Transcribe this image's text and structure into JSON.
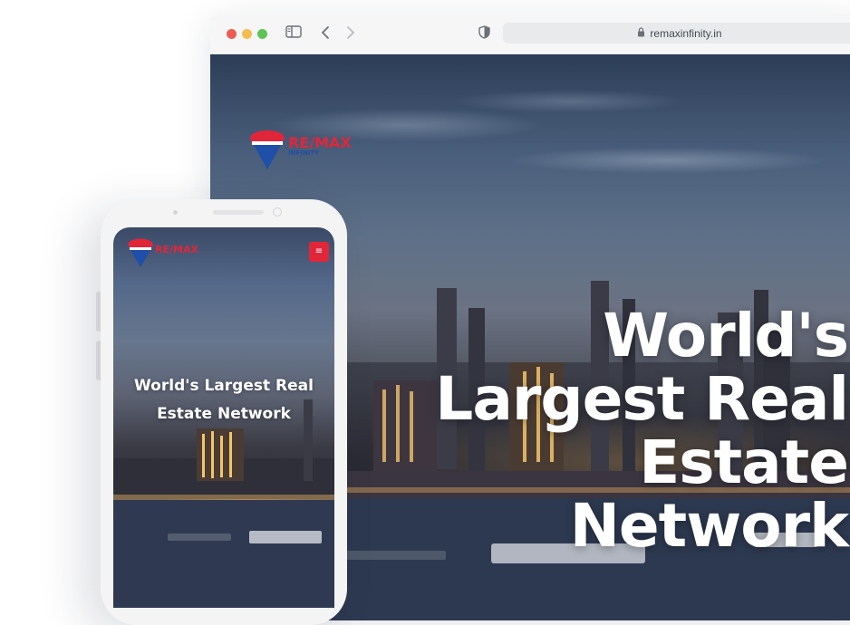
{
  "browser": {
    "url": "remaxinfinity.in",
    "traffic_lights": [
      "#ee5d52",
      "#f5bd4f",
      "#5fc454"
    ],
    "icons": [
      "sidebar-icon",
      "back-icon",
      "forward-icon",
      "shield-icon",
      "lock-icon"
    ]
  },
  "site": {
    "brand": "RE/MAX",
    "brand_sub": "INFINITY",
    "hero_title": "World's Largest Real Estate Network",
    "colors": {
      "red": "#e1263a",
      "blue": "#1f4fa8",
      "white": "#ffffff"
    }
  },
  "mobile": {
    "brand": "RE/MAX",
    "hero_title": "World's Largest Real Estate Network",
    "menu_icon": "hamburger-icon"
  }
}
